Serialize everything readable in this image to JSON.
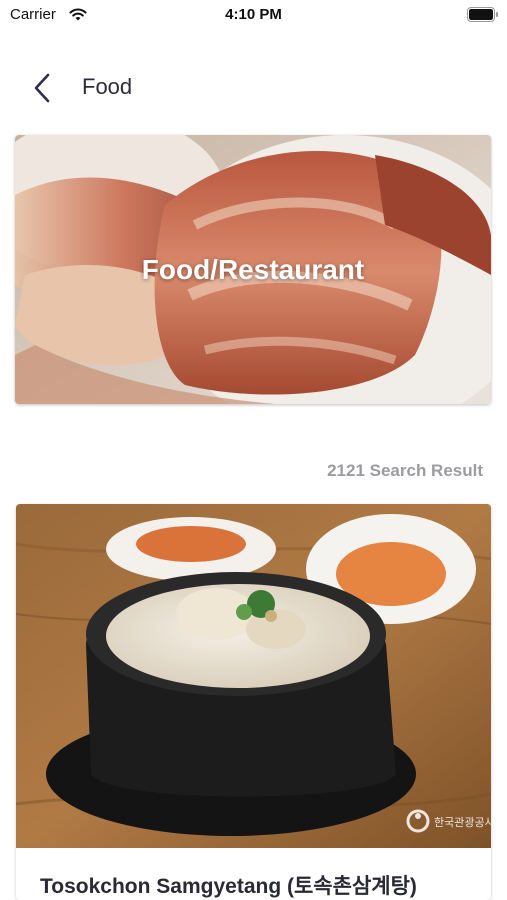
{
  "status_bar": {
    "carrier": "Carrier",
    "time": "4:10 PM",
    "wifi_icon": "wifi-icon",
    "battery_icon": "battery-icon"
  },
  "nav": {
    "title": "Food",
    "back_icon": "chevron-left-icon"
  },
  "hero": {
    "title": "Food/Restaurant"
  },
  "results": {
    "count_label": "2121 Search Result"
  },
  "cards": [
    {
      "title": "Tosokchon Samgyetang (토속촌삼계탕)",
      "watermark": "한국관광공사"
    }
  ],
  "colors": {
    "accent": "#2c2c3a",
    "muted_text": "#9b9ba0"
  }
}
